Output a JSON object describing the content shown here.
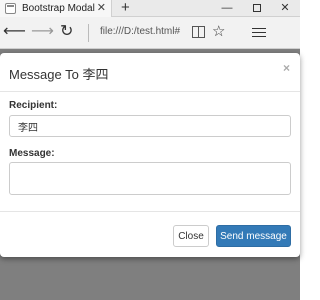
{
  "browser": {
    "tab_title": "Bootstrap Modal",
    "tab_close": "✕",
    "new_tab": "+",
    "address": "file:///D:/test.html#",
    "icons": [
      "back-arrow-icon",
      "forward-arrow-icon",
      "refresh-icon",
      "reading-view-icon",
      "favorite-star-icon",
      "hub-icon"
    ],
    "window_controls": {
      "minimize": "—",
      "close": "✕"
    }
  },
  "modal": {
    "title": "Message To 李四",
    "close_symbol": "×",
    "recipient_label": "Recipient:",
    "recipient_value": "李四",
    "message_label": "Message:",
    "message_value": "",
    "close_button": "Close",
    "send_button": "Send message"
  },
  "colors": {
    "primary": "#337ab7",
    "backdrop": "#7f7f7f"
  }
}
